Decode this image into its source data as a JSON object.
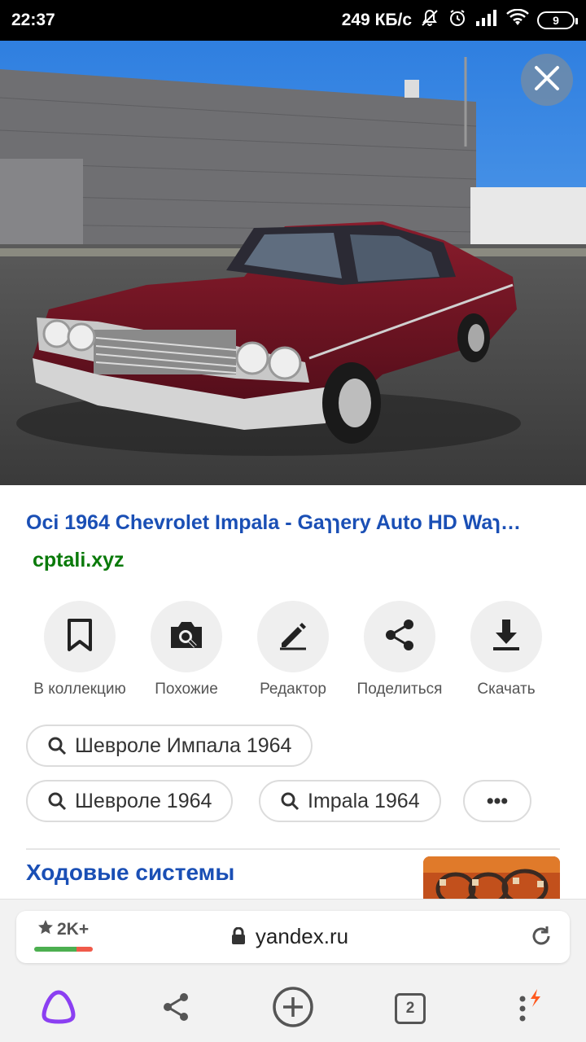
{
  "status_bar": {
    "time": "22:37",
    "speed": "249 КБ/с",
    "battery": "9"
  },
  "photo": {
    "subject": "red 1964 Chevrolet Impala in a parking lot",
    "close_icon": "close-icon"
  },
  "result": {
    "title": "Oci 1964 Chevrolet Impala - Gaɿɿery Auto HD Waɿ…",
    "domain": "cptali.xyz"
  },
  "actions": [
    {
      "label": "В коллекцию",
      "icon": "bookmark-icon"
    },
    {
      "label": "Похожие",
      "icon": "camera-search-icon"
    },
    {
      "label": "Редактор",
      "icon": "pencil-icon"
    },
    {
      "label": "Поделиться",
      "icon": "share-icon"
    },
    {
      "label": "Скачать",
      "icon": "download-icon"
    }
  ],
  "suggestions": [
    "Шевроле Импала 1964",
    "Шевроле 1964",
    "Impala 1964"
  ],
  "more_label": "•••",
  "section": {
    "title": "Ходовые системы"
  },
  "browser": {
    "rating": "2K+",
    "url": "yandex.ru",
    "tabs_count": "2"
  },
  "colors": {
    "link_blue": "#1a4fb5",
    "domain_green": "#0a7a0a",
    "alice_purple": "#8b3ff2",
    "badge_orange": "#ff5a1f"
  }
}
